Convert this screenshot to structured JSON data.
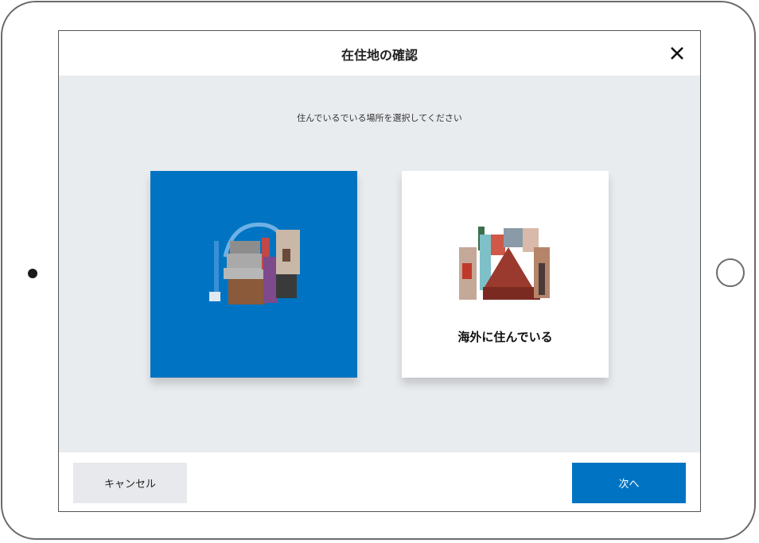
{
  "modal": {
    "title": "在住地の確認",
    "subtitle": "住んでいるでいる場所を選択してください"
  },
  "options": {
    "domestic": {
      "label": "",
      "selected": true,
      "illustration": "japan-landmarks-illustration"
    },
    "overseas": {
      "label": "海外に住んでいる",
      "selected": false,
      "illustration": "overseas-landmarks-illustration"
    }
  },
  "footer": {
    "cancel_label": "キャンセル",
    "next_label": "次へ"
  },
  "colors": {
    "accent": "#0074c2",
    "background": "#e9ecef",
    "cancel_bg": "#e7e9ec"
  },
  "icons": {
    "close": "close-icon"
  }
}
